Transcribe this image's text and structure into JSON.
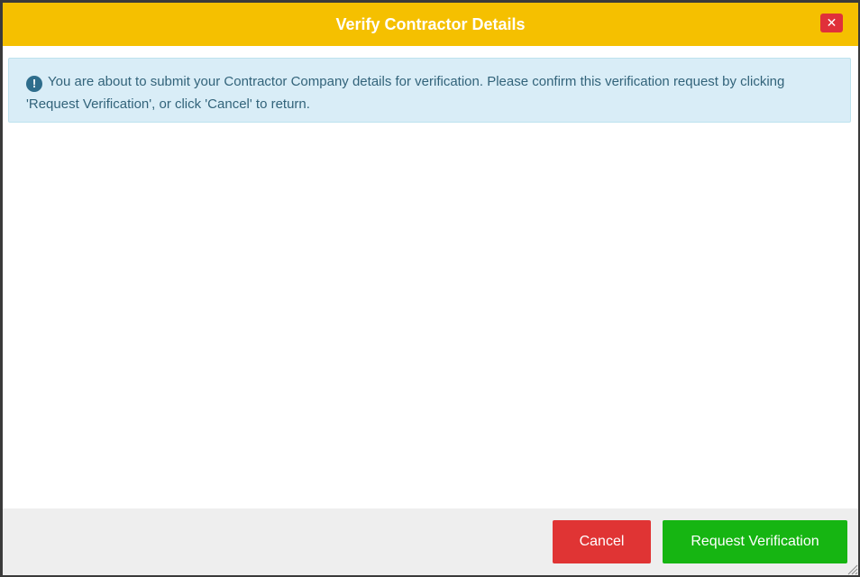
{
  "dialog": {
    "title": "Verify Contractor Details",
    "close_label": "✕"
  },
  "alert": {
    "icon": "exclamation-circle-icon",
    "icon_glyph": "!",
    "message": "You are about to submit your Contractor Company details for verification. Please confirm this verification request by clicking 'Request Verification', or click 'Cancel' to return."
  },
  "footer": {
    "cancel_label": "Cancel",
    "request_label": "Request Verification"
  },
  "colors": {
    "titlebar": "#f5c000",
    "cancel": "#e03434",
    "request": "#16b512",
    "alert_bg": "#d9edf7"
  }
}
